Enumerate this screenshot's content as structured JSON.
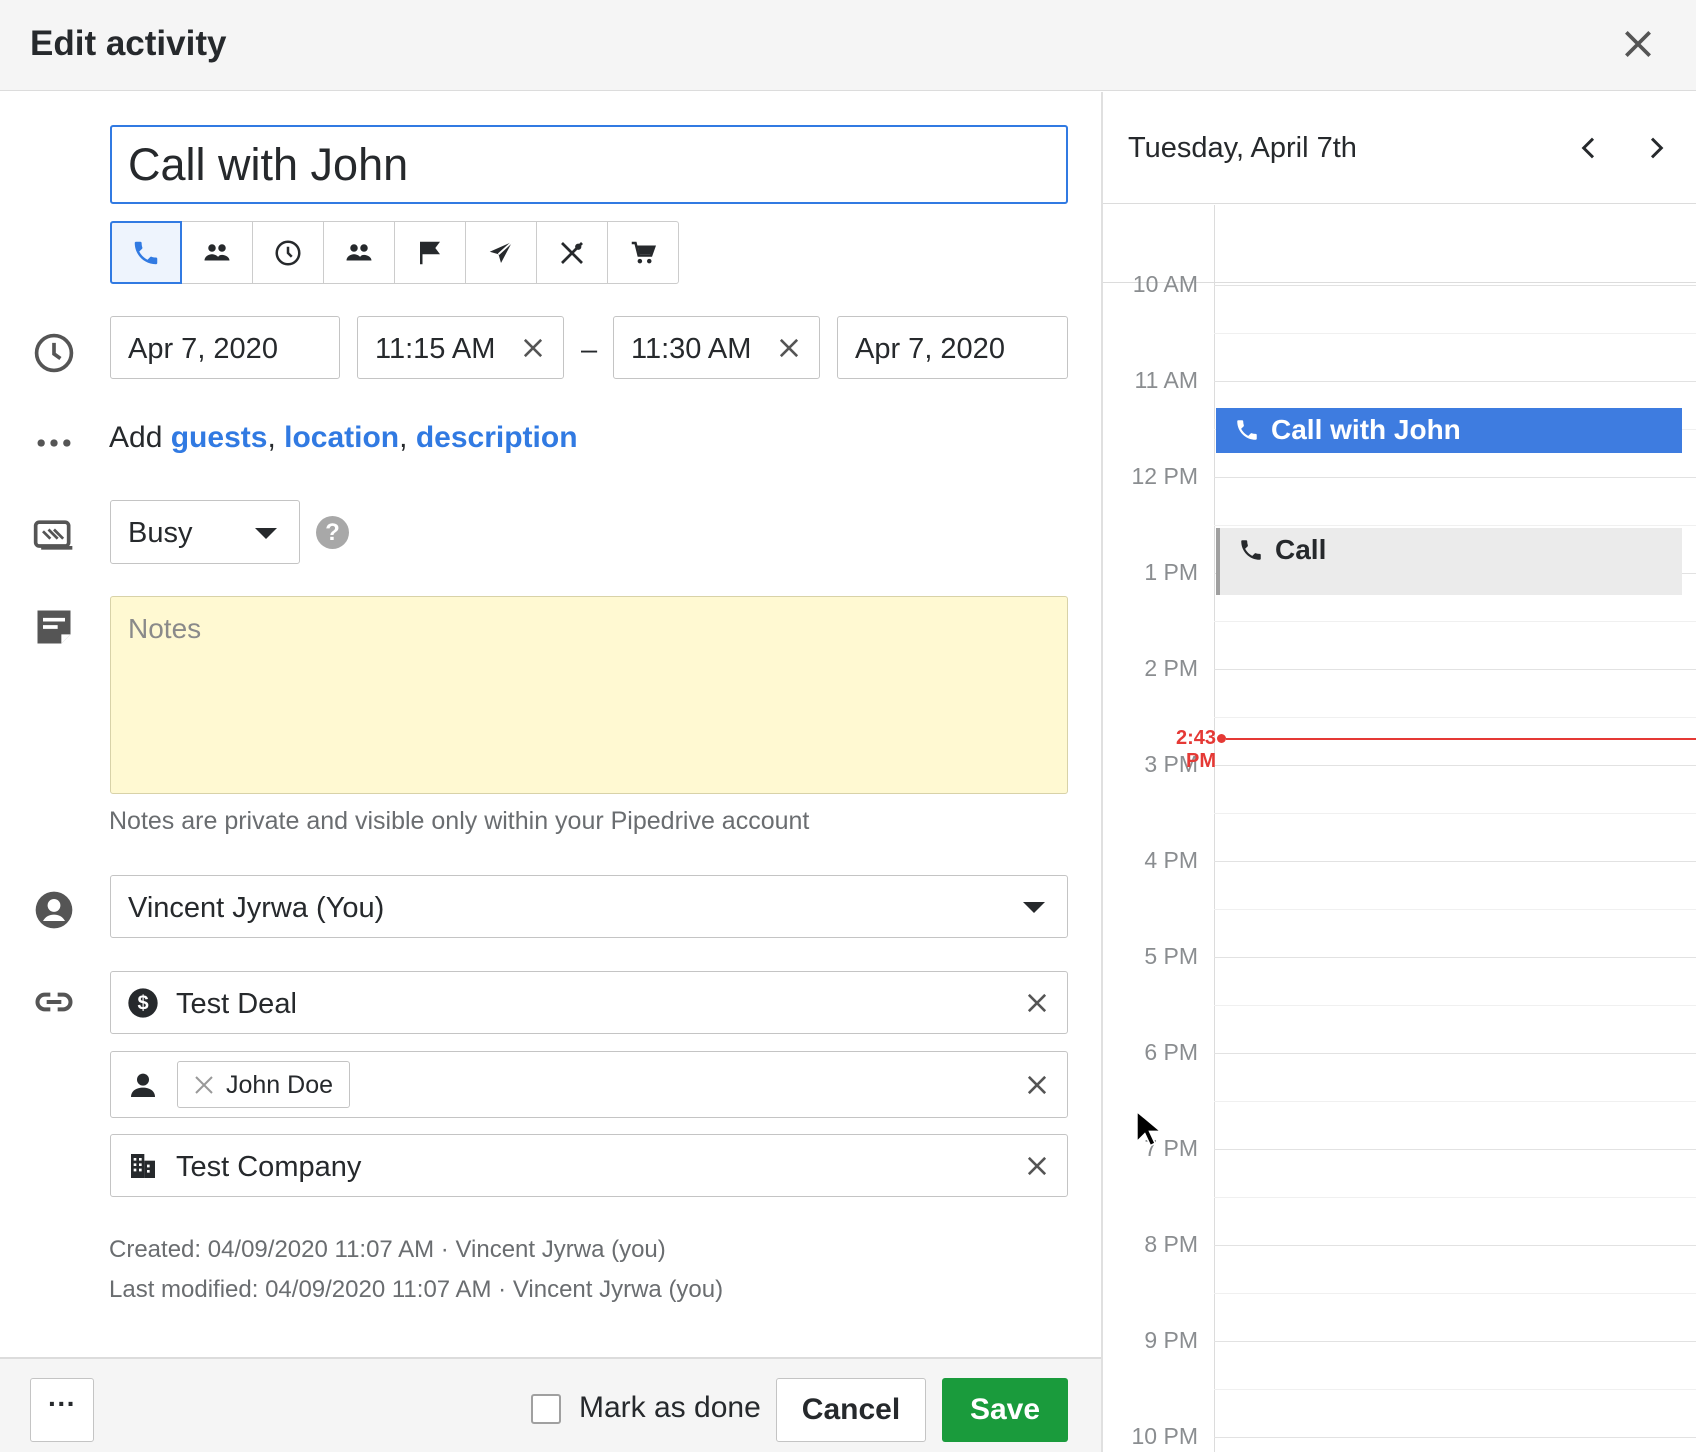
{
  "dialog": {
    "title": "Edit activity"
  },
  "form": {
    "subject": "Call with John",
    "activity_types": [
      "call-icon",
      "meeting-icon",
      "task-icon",
      "people-icon",
      "deadline-icon",
      "email-icon",
      "lunch-icon",
      "cart-icon"
    ],
    "active_type": "call-icon",
    "start_date": "Apr 7, 2020",
    "start_time": "11:15 AM",
    "separator": "–",
    "end_time": "11:30 AM",
    "end_date": "Apr 7, 2020",
    "add_prefix": "Add",
    "add_links": [
      "guests",
      "location",
      "description"
    ],
    "add_sep": ",",
    "busy": "Busy",
    "notes_placeholder": "Notes",
    "notes_hint": "Notes are private and visible only within your Pipedrive account",
    "owner": "Vincent Jyrwa (You)",
    "deal": "Test Deal",
    "person": "John Doe",
    "organization": "Test Company",
    "created": "Created: 04/09/2020 11:07 AM · Vincent Jyrwa (you)",
    "modified": "Last modified: 04/09/2020 11:07 AM · Vincent Jyrwa (you)"
  },
  "footer": {
    "more": "···",
    "mark_done": "Mark as done",
    "cancel": "Cancel",
    "save": "Save"
  },
  "calendar": {
    "date": "Tuesday, April 7th",
    "hours": [
      "10 AM",
      "11 AM",
      "12 PM",
      "1 PM",
      "2 PM",
      "3 PM",
      "4 PM",
      "5 PM",
      "6 PM",
      "7 PM",
      "8 PM",
      "9 PM",
      "10 PM"
    ],
    "events": [
      {
        "title": "Call with John",
        "style": "primary"
      },
      {
        "title": "Call",
        "style": "secondary"
      }
    ],
    "now": "2:43 PM"
  },
  "colors": {
    "accent": "#317ae2",
    "save": "#1a9b3c",
    "notes_bg": "#fff9d2",
    "now_line": "#e53935"
  }
}
